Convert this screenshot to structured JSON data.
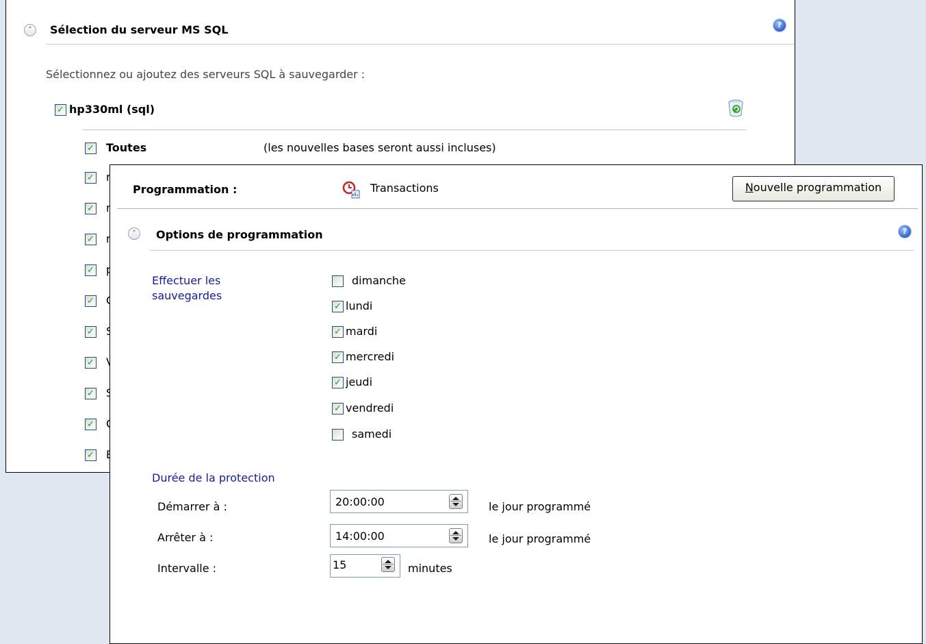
{
  "back_panel": {
    "title": "Sélection du serveur MS SQL",
    "help_icon_label": "?",
    "instruction": "Sélectionnez ou ajoutez des serveurs SQL à sauvegarder :",
    "server": {
      "label": "hp330ml (sql)",
      "checked": true
    },
    "databases": [
      {
        "label": "Toutes",
        "checked": true,
        "note": "(les nouvelles bases seront aussi incluses)"
      },
      {
        "label": "r",
        "checked": true
      },
      {
        "label": "r",
        "checked": true
      },
      {
        "label": "r",
        "checked": true
      },
      {
        "label": "p",
        "checked": true
      },
      {
        "label": "C",
        "checked": true
      },
      {
        "label": "S",
        "checked": true
      },
      {
        "label": "V",
        "checked": true
      },
      {
        "label": "S",
        "checked": true
      },
      {
        "label": "C",
        "checked": true
      },
      {
        "label": "E",
        "checked": true
      }
    ]
  },
  "front_panel": {
    "programmation_label": "Programmation :",
    "schedule_type": "Transactions",
    "new_schedule_button": "Nouvelle programmation",
    "options_title": "Options de programmation",
    "help_icon_label": "?",
    "perform_backups_label": "Effectuer les sauvegardes",
    "days": [
      {
        "label": "dimanche",
        "checked": false
      },
      {
        "label": "lundi",
        "checked": true
      },
      {
        "label": "mardi",
        "checked": true
      },
      {
        "label": "mercredi",
        "checked": true
      },
      {
        "label": "jeudi",
        "checked": true
      },
      {
        "label": "vendredi",
        "checked": true
      },
      {
        "label": "samedi",
        "checked": false
      }
    ],
    "protection_title": "Durée de la protection",
    "start": {
      "label": "Démarrer à :",
      "value": "20:00:00",
      "suffix": "le jour programmé"
    },
    "stop": {
      "label": "Arrêter à :",
      "value": "14:00:00",
      "suffix": "le jour programmé"
    },
    "interval": {
      "label": "Intervalle :",
      "value": "15",
      "suffix": "minutes"
    }
  },
  "colors": {
    "check": "#21a121",
    "section_label": "#1a1a9e",
    "background": "#dfe7f1"
  }
}
